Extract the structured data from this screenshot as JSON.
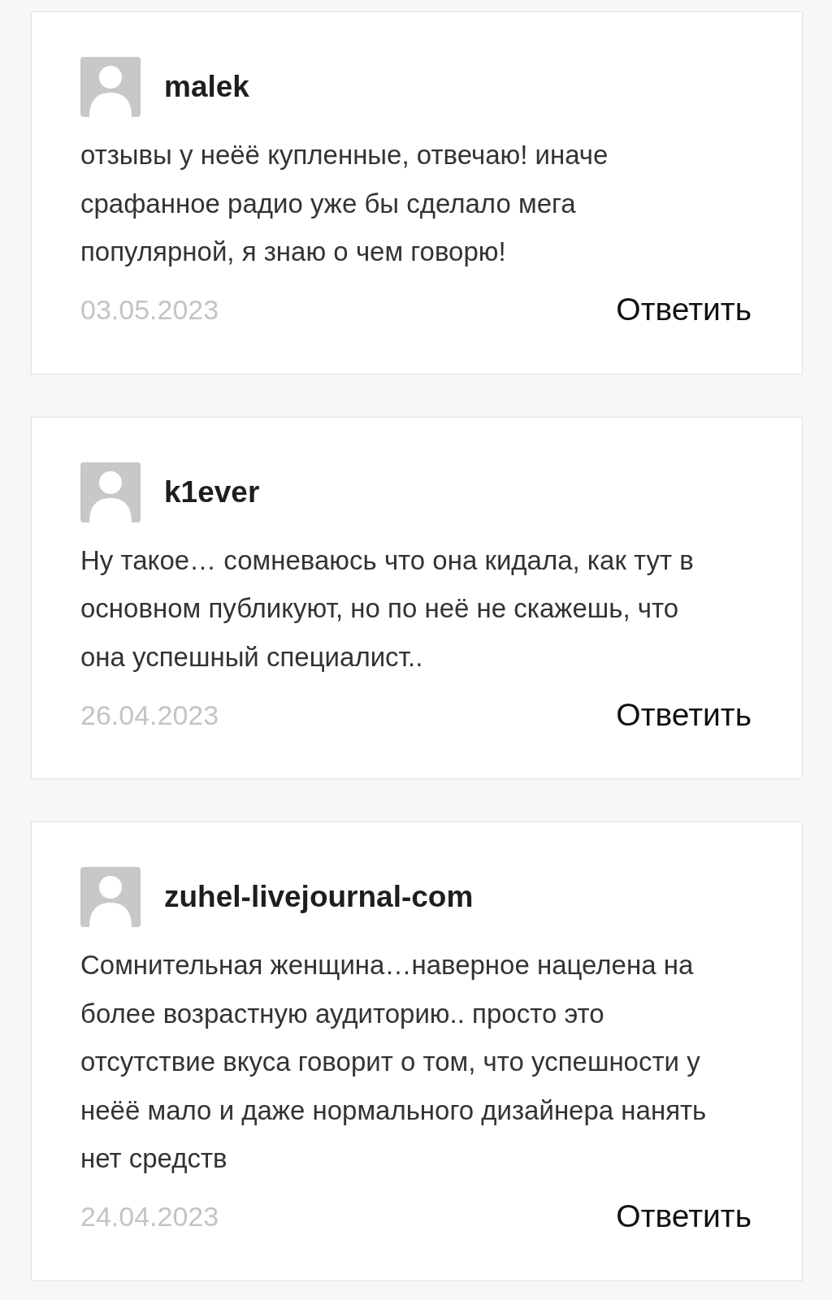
{
  "comments": [
    {
      "author": "malek",
      "text": "отзывы у неёё купленные, отвечаю! иначе срафанное радио уже бы сделало мега популярной, я знаю о чем говорю!",
      "date": "03.05.2023",
      "reply": "Ответить"
    },
    {
      "author": "k1ever",
      "text": "Ну такое… сомневаюсь что она кидала, как тут в основном публикуют, но по неё не скажешь, что она успешный специалист..",
      "date": "26.04.2023",
      "reply": "Ответить"
    },
    {
      "author": "zuhel-livejournal-com",
      "text": "Сомнительная женщина…наверное нацелена на более возрастную аудиторию.. просто это отсутствие вкуса говорит о том, что успешности у неёё мало и даже нормального дизайнера нанять нет средств",
      "date": "24.04.2023",
      "reply": "Ответить"
    }
  ]
}
